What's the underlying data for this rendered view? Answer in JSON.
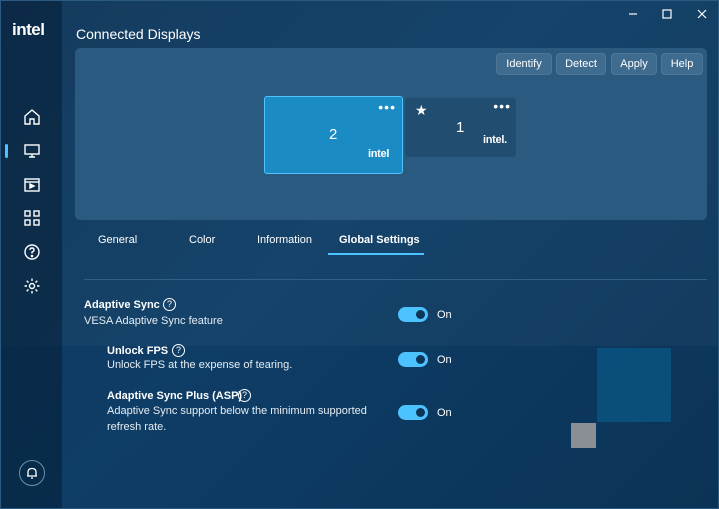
{
  "app": {
    "logo": "intel"
  },
  "page": {
    "title": "Connected Displays"
  },
  "window_controls": [
    "minimize-icon",
    "maximize-icon",
    "close-icon"
  ],
  "sidebar": {
    "items": [
      {
        "icon": "home-icon"
      },
      {
        "icon": "display-icon",
        "active": true
      },
      {
        "icon": "video-icon"
      },
      {
        "icon": "apps-grid-icon"
      },
      {
        "icon": "help-icon"
      },
      {
        "icon": "gear-icon"
      }
    ],
    "bottom_icon": "bell-icon"
  },
  "toolbar": {
    "identify": "Identify",
    "detect": "Detect",
    "apply": "Apply",
    "help": "Help"
  },
  "displays": [
    {
      "number": "2",
      "brand": "intel",
      "selected": true,
      "more": "•••"
    },
    {
      "number": "1",
      "brand": "intel.",
      "primary": true,
      "more": "•••"
    }
  ],
  "tabs": [
    "General",
    "Color",
    "Information",
    "Global Settings"
  ],
  "active_tab": "Global Settings",
  "settings": [
    {
      "title": "Adaptive Sync",
      "description": "VESA Adaptive Sync feature",
      "state": "On"
    },
    {
      "title": "Unlock FPS",
      "description": "Unlock FPS at the expense of tearing.",
      "state": "On"
    },
    {
      "title": "Adaptive Sync Plus (ASP)",
      "description_line1": "Adaptive Sync support below the minimum supported",
      "description_line2": "refresh rate.",
      "state": "On"
    }
  ],
  "colors": {
    "accent": "#4cc2ff",
    "background": "#0d3558",
    "panel": "#2a5a80"
  }
}
